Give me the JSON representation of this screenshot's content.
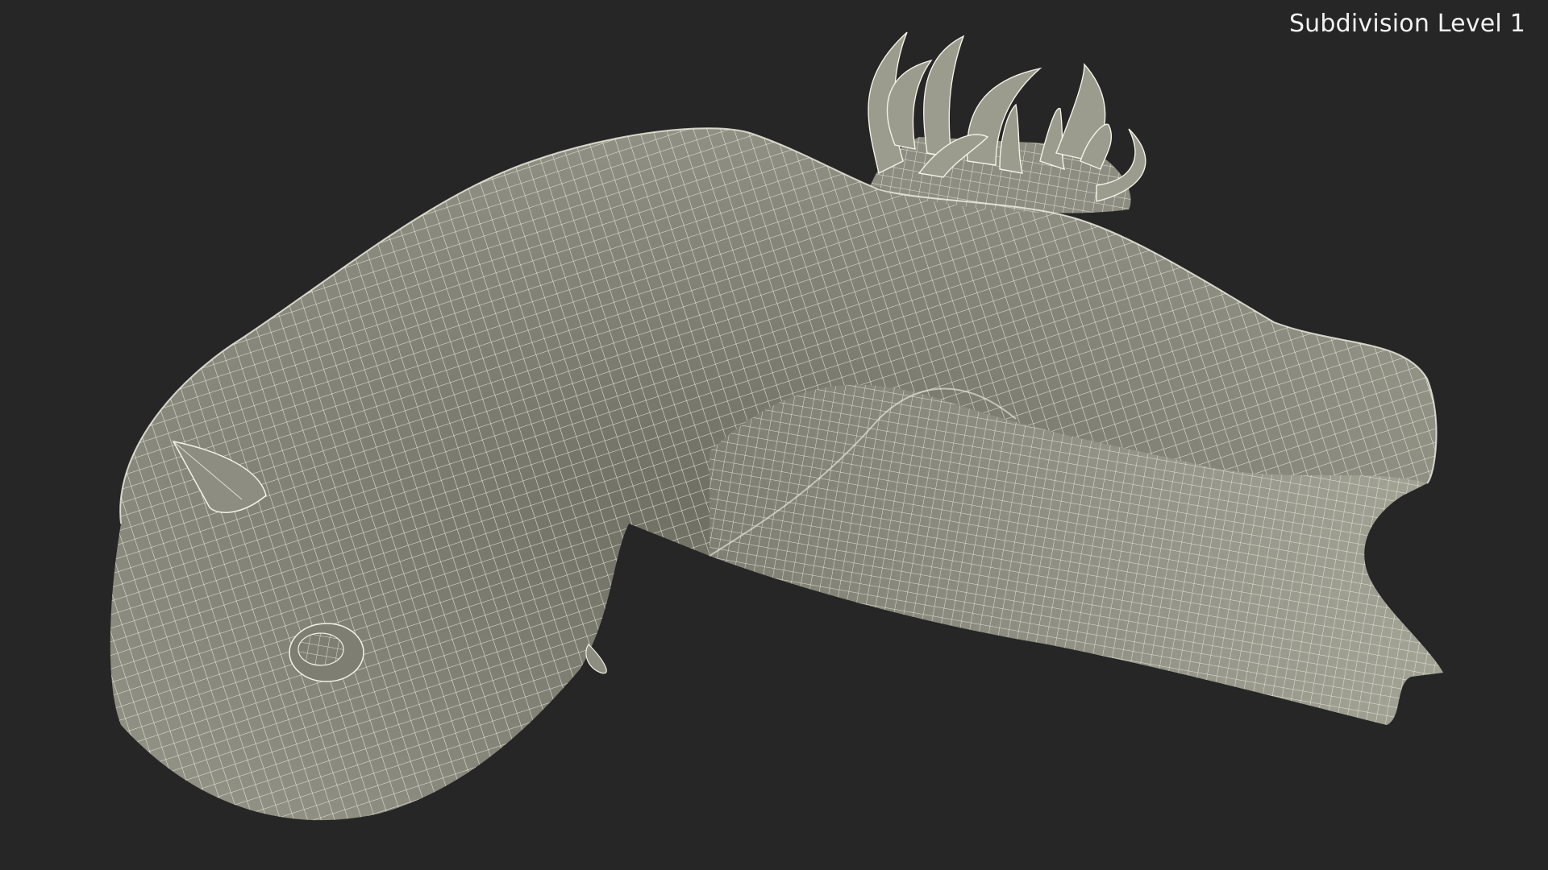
{
  "viewport": {
    "overlay_label": "Subdivision Level 1",
    "background_color": "#262626",
    "surface_color": "#8a8a7e",
    "wire_color": "#f4f2e6",
    "render_mode": "wireframe-on-shaded",
    "subject": "sea slug mesh"
  }
}
